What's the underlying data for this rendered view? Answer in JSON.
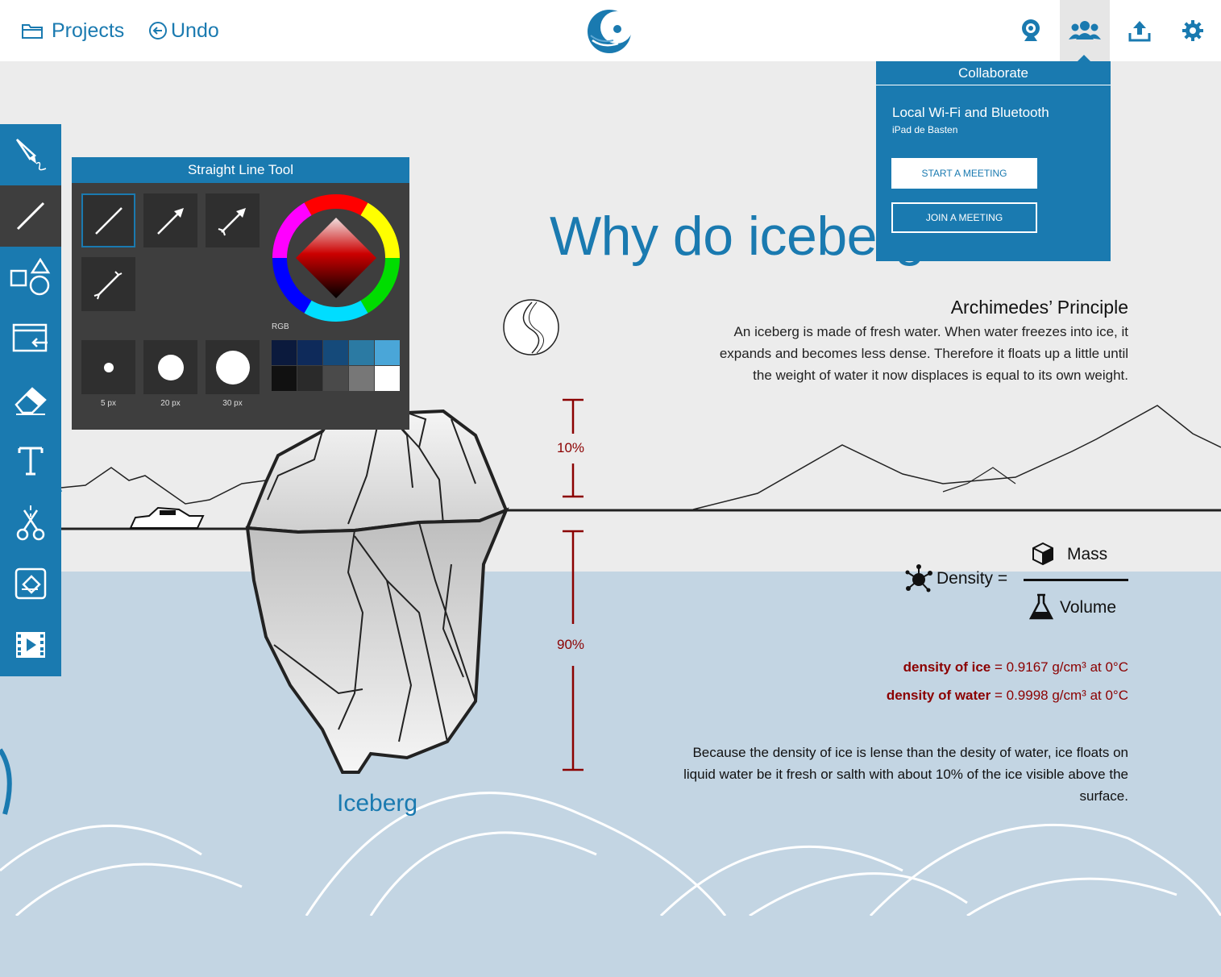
{
  "app": {
    "brand_icon": "moon-wave-logo"
  },
  "toolbar": {
    "projects_label": "Projects",
    "undo_label": "Undo",
    "right_icons": [
      "webcam-icon",
      "collaborate-icon",
      "export-icon",
      "settings-icon"
    ]
  },
  "sidebar": {
    "tools": [
      "pen-tool",
      "straight-line-tool",
      "shapes-tool",
      "import-tool",
      "eraser-tool",
      "text-tool",
      "scissors-tool",
      "fill-tool",
      "media-tool"
    ],
    "active_tool": "straight-line-tool"
  },
  "line_tool_panel": {
    "title": "Straight Line Tool",
    "line_styles": [
      "plain-line",
      "arrow-line",
      "double-arrow-line",
      "bone-line"
    ],
    "selected_style": "plain-line",
    "color_model_label": "RGB",
    "sizes": [
      {
        "label": "5 px"
      },
      {
        "label": "20 px"
      },
      {
        "label": "30 px"
      }
    ],
    "swatches": [
      "#0b1a3d",
      "#0e2a5a",
      "#154a7a",
      "#2b7aa3",
      "#4aa6d8",
      "#111111",
      "#2a2a2a",
      "#4a4a4a",
      "#777777",
      "#ffffff"
    ]
  },
  "collaborate": {
    "header": "Collaborate",
    "connection_title": "Local Wi-Fi and Bluetooth",
    "device_name": "iPad de Basten",
    "start_label": "START A MEETING",
    "join_label": "JOIN A MEETING"
  },
  "slide": {
    "headline": "Why do icebergs float?",
    "principle_title": "Archimedes’ Principle",
    "principle_text": "An iceberg is made of fresh water. When water freezes into ice, it expands and becomes less dense. Therefore it floats up a little until the weight of water it now displaces is equal to its own weight.",
    "above_pct": "10%",
    "below_pct": "90%",
    "iceberg_label": "Iceberg",
    "density_label": "Density =",
    "mass_label": "Mass",
    "volume_label": "Volume",
    "ice_density_name": "density of ice",
    "ice_density_value": " = 0.9167 g/cm³ at 0°C",
    "water_density_name": "density of water",
    "water_density_value": " = 0.9998 g/cm³ at 0°C",
    "conclusion": "Because the density of ice is lense than the desity of water, ice floats on liquid water be it fresh or salth with about 10% of the ice visible above the surface."
  },
  "colors": {
    "accent": "#1a7ab0",
    "water": "#c3d5e3",
    "sky": "#ececec",
    "measure_red": "#8b0000"
  }
}
